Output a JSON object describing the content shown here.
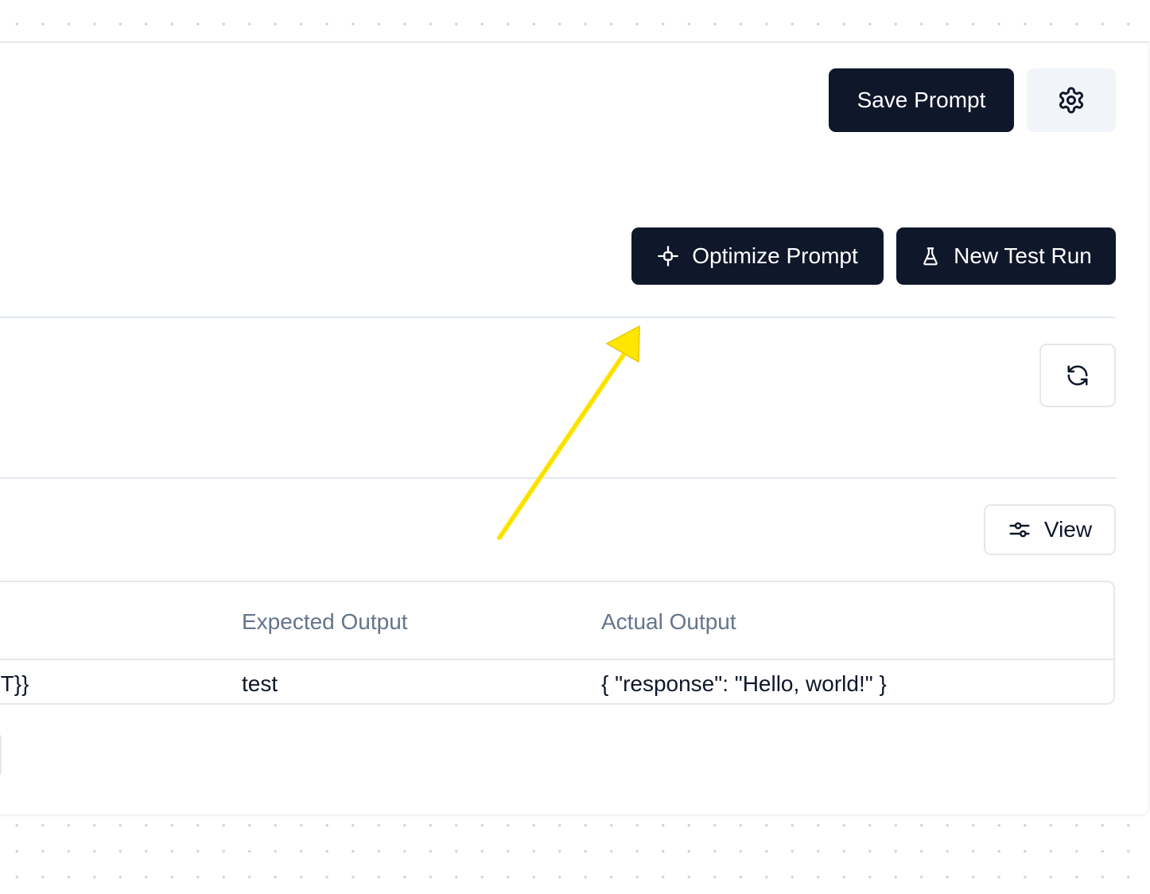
{
  "header": {
    "save_label": "Save Prompt",
    "settings_icon": "gear-icon"
  },
  "actions": {
    "optimize_label": "Optimize Prompt",
    "optimize_icon": "sparkle-icon",
    "new_test_run_label": "New Test Run",
    "new_test_run_icon": "flask-icon"
  },
  "refresh": {
    "icon": "refresh-icon"
  },
  "view": {
    "label": "View",
    "icon": "sliders-icon"
  },
  "table": {
    "columns": [
      "Expected Output",
      "Actual Output"
    ],
    "rows": [
      {
        "truncated_cell": "PT}}",
        "expected_output": "test",
        "actual_output": "{ \"response\": \"Hello, world!\" }"
      }
    ]
  },
  "annotation": {
    "arrow_color": "#FFE600"
  },
  "colors": {
    "primary_button": "#0F172A",
    "muted_text": "#64748B",
    "border": "#E5E7EB"
  }
}
